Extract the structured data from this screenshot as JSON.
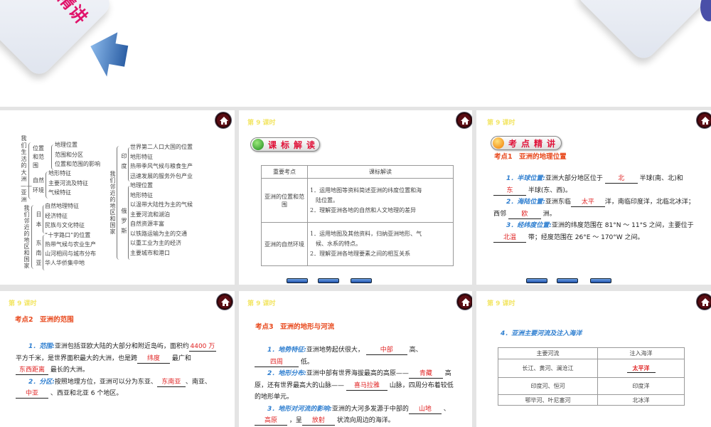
{
  "top": {
    "banner_text": "精讲"
  },
  "lesson": "第 9 课时",
  "slide1": {
    "root1": "我们生活的大洲——亚洲",
    "g1": "位置和范围",
    "g1_items": [
      "地理位置",
      "范围和分区",
      "位置和范围的影响"
    ],
    "g2": "自然环境",
    "g2_items": [
      "地形特征",
      "主要河流及特征",
      "气候特征"
    ],
    "root2": "我们邻近的地区和国家",
    "g3": "日本",
    "g3_items": [
      "自然地理特征",
      "经济特征",
      "民族与文化特征"
    ],
    "g4": "东南亚",
    "g4_items": [
      "“十字路口”的位置",
      "热带气候与农业生产",
      "山河相间与城市分布",
      "华人华侨集中地"
    ],
    "root3": "我们邻近的地区和国家",
    "g5": "印度",
    "g5_items": [
      "世界第二人口大国的位置",
      "地形特征",
      "热带季风气候与粮食生产",
      "迅速发展的服务外包产业"
    ],
    "g6": "俄罗斯",
    "g6_items": [
      "地理位置",
      "地形特征",
      "以温带大陆性为主的气候",
      "主要河流和湖泊",
      "自然资源丰富",
      "以铁路运输为主的交通",
      "以重工业为主的经济",
      "主要城市和港口"
    ]
  },
  "slide2": {
    "pill": "课标解读",
    "headers": [
      "重要考点",
      "课标解读"
    ],
    "rows": [
      {
        "topic": "亚洲的位置和范围",
        "lines": [
          "1．运用地图等资料简述亚洲的纬度位置和海",
          "　陆位置。",
          "2．理解亚洲各地的自然和人文地理的差异"
        ]
      },
      {
        "topic": "亚洲的自然环境",
        "lines": [
          "1．运用地图及其他资料，归纳亚洲地形、气",
          "　候、水系的特点。",
          "2．理解亚洲各地理要素之间的相互关系"
        ]
      }
    ]
  },
  "slide3": {
    "pill": "考点精讲",
    "title": "考点1　亚洲的地理位置",
    "p1_label": "1．半球位置:",
    "p1_a": "亚洲大部分地区位于",
    "b1": "北",
    "p1_b": "半球(南、北)和",
    "b2": "东",
    "p1_c": "半球(东、西)。",
    "p2_label": "2．海陆位置:",
    "p2_a": "亚洲东临",
    "b3": "太平",
    "p2_b": "洋，南临印度洋，北临北冰洋；西邻",
    "b4": "欧",
    "p2_c": "洲。",
    "p3_label": "3．经纬度位置:",
    "p3_a": "亚洲的纬度范围在 81°N ～ 11°S 之间，主要位于",
    "b5": "北温",
    "p3_b": "带；经度范围在 26°E ～ 170°W 之间。"
  },
  "slide4": {
    "title": "考点2　亚洲的范围",
    "p1_label": "1．范围:",
    "p1_a": "亚洲包括亚欧大陆的大部分和附近岛屿，面积约",
    "b1": "4400 万",
    "p1_b": "平方千米，是世界面积最大的大洲，也是跨",
    "b2": "纬度",
    "p1_c": "最广和",
    "b3": "东西距离",
    "p1_d": "最长的大洲。",
    "p2_label": "2．分区:",
    "p2_a": "按照地理方位，亚洲可以分为东亚、",
    "b4": "东南亚",
    "p2_b": "、南亚、",
    "b5": "中亚",
    "p2_c": "、西亚和北亚 6 个地区。"
  },
  "slide5": {
    "title": "考点3　亚洲的地形与河流",
    "p1_label": "1．地势特征:",
    "p1_a": "亚洲地势起伏很大，",
    "b1": "中部",
    "p1_b": "高、",
    "b2": "四周",
    "p1_c": "低。",
    "p2_label": "2．地形分布:",
    "p2_a": "亚洲中部有世界海拔最高的高原——",
    "b3": "青藏",
    "p2_b": "高原，还有世界最高大的山脉——",
    "b4": "喜马拉雅",
    "p2_c": "山脉，四周分布着较低的地形单元。",
    "p3_label": "3．地形对河流的影响:",
    "p3_a": "亚洲的大河多发源于中部的",
    "b5": "山地",
    "p3_b": "、",
    "b6": "高原",
    "p3_c": "，呈",
    "b7": "放射",
    "p3_d": "状流向周边的海洋。"
  },
  "slide6": {
    "heading": "4．亚洲主要河流及注入海洋",
    "headers": [
      "主要河流",
      "注入海洋"
    ],
    "rows": [
      [
        "长江、黄河、澜沧江",
        "太平洋"
      ],
      [
        "印度河、恒河",
        "印度洋"
      ],
      [
        "鄂毕河、叶尼塞河",
        "北冰洋"
      ]
    ]
  },
  "colors": {
    "accent_red": "#e02424",
    "label_blue": "#2f7fd0",
    "lesson_yellow": "#f3e668"
  }
}
